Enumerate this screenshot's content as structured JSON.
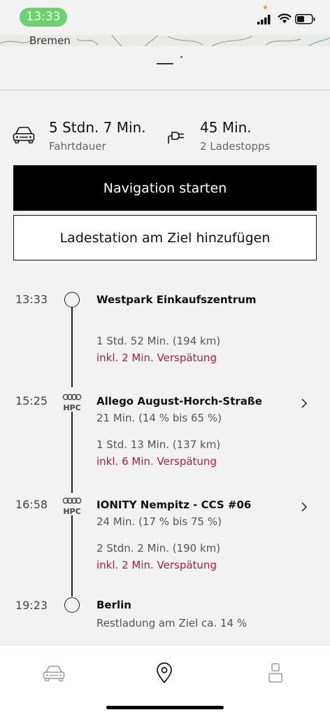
{
  "status_bar": {
    "time": "13:33"
  },
  "map": {
    "city_label": "Bremen"
  },
  "summary": {
    "duration": {
      "value": "5 Stdn. 7 Min.",
      "label": "Fahrtdauer",
      "icon": "car-icon"
    },
    "charging": {
      "value": "45 Min.",
      "label": "2 Ladestopps",
      "icon": "charging-plug-icon"
    }
  },
  "actions": {
    "start_navigation": "Navigation starten",
    "add_charging_station": "Ladestation am Ziel hinzufügen"
  },
  "route": {
    "stops": [
      {
        "time": "13:33",
        "name": "Westpark Einkaufszentrum",
        "type": "start",
        "charge": ""
      },
      {
        "time": "15:25",
        "name": "Allego August-Horch-Straße",
        "type": "hpc",
        "charge": "21 Min. (14 % bis 65 %)"
      },
      {
        "time": "16:58",
        "name": "IONITY Nempitz - CCS #06",
        "type": "hpc",
        "charge": "24 Min. (17 % bis 75 %)"
      },
      {
        "time": "19:23",
        "name": "Berlin",
        "type": "destination",
        "charge": "Restladung am Ziel ca. 14 %"
      }
    ],
    "legs": [
      {
        "drive": "1 Std. 52 Min. (194 km)",
        "delay": "inkl. 2 Min. Verspätung"
      },
      {
        "drive": "1 Std. 13 Min. (137 km)",
        "delay": "inkl. 6 Min. Verspätung"
      },
      {
        "drive": "2 Stdn. 2 Min. (190 km)",
        "delay": "inkl. 2 Min. Verspätung"
      }
    ],
    "hpc_label": "HPC"
  },
  "colors": {
    "delay_red": "#b0203a",
    "status_green": "#6bd36b",
    "primary_button": "#000000"
  },
  "bottom_nav": {
    "items": [
      {
        "icon": "car-icon",
        "active": false
      },
      {
        "icon": "map-pin-icon",
        "active": true
      },
      {
        "icon": "profile-icon",
        "active": false
      }
    ]
  }
}
